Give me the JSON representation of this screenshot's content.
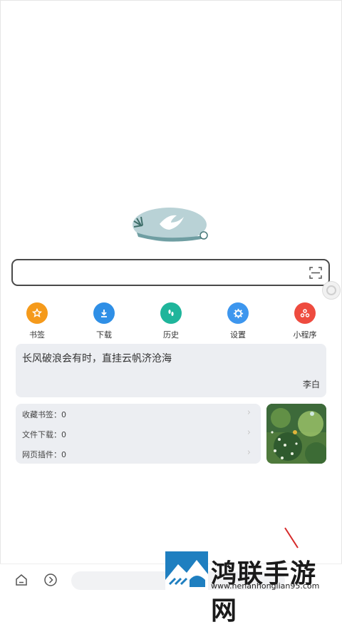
{
  "search": {
    "value": "",
    "placeholder": ""
  },
  "quick_actions": [
    {
      "label": "书签",
      "icon": "star-icon",
      "color": "#f59a1b"
    },
    {
      "label": "下载",
      "icon": "download-icon",
      "color": "#2f8fe6"
    },
    {
      "label": "历史",
      "icon": "footprint-icon",
      "color": "#1fb59b"
    },
    {
      "label": "设置",
      "icon": "gear-icon",
      "color": "#3d96ee"
    },
    {
      "label": "小程序",
      "icon": "mini-program-icon",
      "color": "#ee4b3f"
    }
  ],
  "quote": {
    "text": "长风破浪会有时，直挂云帆济沧海",
    "author": "李白"
  },
  "stats": [
    {
      "label": "收藏书签：0"
    },
    {
      "label": "文件下载：0"
    },
    {
      "label": "网页插件：0"
    }
  ],
  "watermark": {
    "name": "鸿联手游网",
    "url": "www.henanhonglian95.com"
  }
}
